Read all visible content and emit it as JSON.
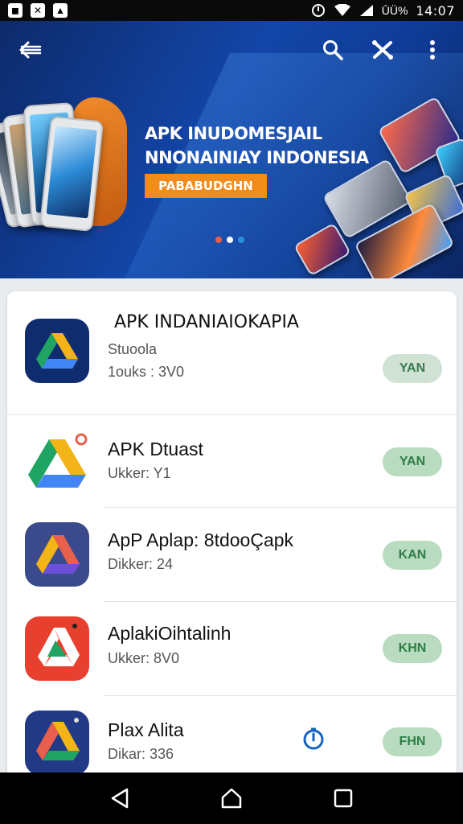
{
  "status_bar": {
    "left_icons": [
      "notification-icon",
      "gallery-icon",
      "image-icon"
    ],
    "battery": "ŪÜ%",
    "time": "14:07"
  },
  "toolbar": {
    "icons": [
      "back-arrow-icon",
      "search-icon",
      "share-icon",
      "more-vert-icon"
    ]
  },
  "hero": {
    "title_line1": "APK INUDOMESJAIL",
    "title_line2": "NNONAINIAY INDONESIA",
    "cta_label": "PABABUDGHN",
    "dots": [
      {
        "color": "#e8604c"
      },
      {
        "color": "#ffffff"
      },
      {
        "color": "#2e8fd8"
      }
    ]
  },
  "apps": [
    {
      "name": "APK INDANIAIOKAPIA",
      "subtitle": "Stuoola",
      "meta": "1ouks : 3V0",
      "button": "YAN",
      "icon": "drive-icon-blue"
    },
    {
      "name": "APK Dtuast",
      "subtitle": "",
      "meta": "Ukker: Y1",
      "button": "YAN",
      "icon": "drive-icon-white"
    },
    {
      "name": "ApP Aplap: 8tdooÇapk",
      "subtitle": "",
      "meta": "Dikker: 24",
      "button": "KAN",
      "icon": "drive-icon-slate"
    },
    {
      "name": "AplakiOihtalinh",
      "subtitle": "",
      "meta": "Ukker: 8V0",
      "button": "KHN",
      "icon": "drive-icon-red"
    },
    {
      "name": "Plax Alita",
      "subtitle": "",
      "meta": "Dikar: 336",
      "button": "FHN",
      "icon": "drive-icon-navy"
    }
  ],
  "nav": {
    "icons": [
      "back-triangle-icon",
      "home-icon",
      "recents-icon"
    ]
  }
}
